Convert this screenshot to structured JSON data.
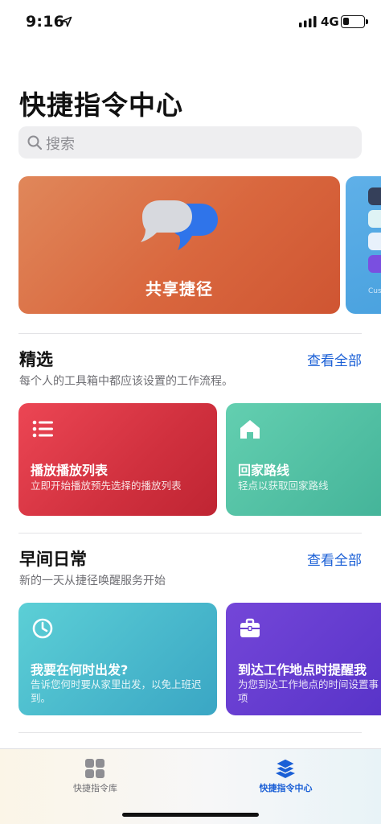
{
  "status_bar": {
    "time": "9:16",
    "network": "4G",
    "battery_level": 0.3
  },
  "page": {
    "title": "快捷指令中心"
  },
  "search": {
    "placeholder": "搜索"
  },
  "hero": {
    "label": "共享捷径",
    "next_peek_text": "Cus"
  },
  "sections": [
    {
      "title": "精选",
      "link": "查看全部",
      "subtitle": "每个人的工具箱中都应该设置的工作流程。",
      "cards": [
        {
          "title": "播放播放列表",
          "description": "立即开始播放预先选择的播放列表",
          "icon": "list-icon"
        },
        {
          "title": "回家路线",
          "description": "轻点以获取回家路线",
          "icon": "house-icon"
        }
      ]
    },
    {
      "title": "早间日常",
      "link": "查看全部",
      "subtitle": "新的一天从捷径唤醒服务开始",
      "cards": [
        {
          "title": "我要在何时出发?",
          "description": "告诉您何时要从家里出发，以免上班迟到。",
          "icon": "clock-icon"
        },
        {
          "title": "到达工作地点时提醒我",
          "description": "为您到达工作地点的时间设置事项",
          "icon": "briefcase-icon"
        }
      ]
    }
  ],
  "tab_bar": {
    "tabs": [
      {
        "label": "快捷指令库",
        "icon": "grid-icon",
        "selected": false
      },
      {
        "label": "快捷指令中心",
        "icon": "layers-icon",
        "selected": true
      }
    ]
  },
  "colors": {
    "accent": "#1a5fd6",
    "hero": "#d9673e",
    "tab_inactive": "#8e8e93"
  }
}
